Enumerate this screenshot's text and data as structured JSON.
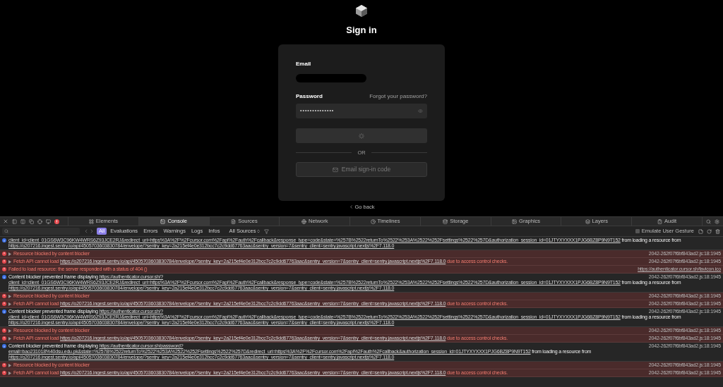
{
  "page": {
    "title": "Sign in",
    "email_label": "Email",
    "password_label": "Password",
    "forgot_link": "Forgot your password?",
    "password_value": "••••••••••••••",
    "submit": {
      "loading": true
    },
    "divider": "OR",
    "email_code_button": {
      "label": "Email sign-in code",
      "disabled": true
    },
    "back_link": "Go back"
  },
  "devtools": {
    "tabs": [
      {
        "label": "Elements",
        "selected": false
      },
      {
        "label": "Console",
        "selected": true
      },
      {
        "label": "Sources",
        "selected": false
      },
      {
        "label": "Network",
        "selected": false
      },
      {
        "label": "Timelines",
        "selected": false
      },
      {
        "label": "Storage",
        "selected": false
      },
      {
        "label": "Graphics",
        "selected": false
      },
      {
        "label": "Layers",
        "selected": false
      },
      {
        "label": "Audit",
        "selected": false
      }
    ],
    "levels": [
      {
        "label": "All",
        "selected": true
      },
      {
        "label": "Evaluations",
        "selected": false
      },
      {
        "label": "Errors",
        "selected": false
      },
      {
        "label": "Warnings",
        "selected": false
      },
      {
        "label": "Logs",
        "selected": false
      },
      {
        "label": "Infos",
        "selected": false
      }
    ],
    "sources_dropdown": "All Sources",
    "emulate_gesture": {
      "label": "Emulate User Gesture",
      "checked": false
    },
    "messages": [
      {
        "kind": "info",
        "expandable": false,
        "lines": [
          [
            {
              "kind": "link",
              "text": "client_id=client_01GS6W3C96KW4WRS6Z93JCE2RJ&redirect_uri=https%3A%2F%2Fcursor.com%2Fapi%2Fauth%2Fcallback&response_type=code&state=%257B%2522returnTo%2522%253A%2522%252Fsettings%2522%257D&authorization_session_id=01JTYXYXXX1PJG6BZ8P9N9T152"
            },
            {
              "kind": "text",
              "text": " from loading a resource from"
            }
          ],
          [
            {
              "kind": "link",
              "text": "https://o207216.ingest.sentry.io/api/4505703603830784/envelope/?sentry_key=2a215ef4e0e312bcc7c2c9dd67763aac&sentry_version=7&sentry_client=sentry.javascript.nextjs%2F7.118.0"
            }
          ]
        ]
      },
      {
        "kind": "error",
        "expandable": true,
        "lines": [
          [
            {
              "kind": "text",
              "text": "Resource blocked by content blocker"
            }
          ]
        ],
        "source": {
          "text": "2042-262f07f6bf843ad2.js:18:1945",
          "link": false
        }
      },
      {
        "kind": "error",
        "expandable": true,
        "lines": [
          [
            {
              "kind": "text",
              "text": "Fetch API cannot load "
            },
            {
              "kind": "link",
              "text": "https://o207216.ingest.sentry.io/api/4505703603830784/envelope/?sentry_key=2a215ef4e0e312bcc7c2c9dd67763aac&sentry_version=7&sentry_client=sentry.javascript.nextjs%2F7.118.0"
            },
            {
              "kind": "text",
              "text": " due to access control checks."
            }
          ]
        ],
        "source": {
          "text": "2042-262f07f6bf843ad2.js:18:1945",
          "link": false
        }
      },
      {
        "kind": "error",
        "expandable": false,
        "lines": [
          [
            {
              "kind": "text",
              "text": "Failed to load resource: the server responded with a status of 404 ()"
            }
          ]
        ],
        "source": {
          "text": "https://authenticator.cursor.sh/favicon.ico",
          "link": true
        }
      },
      {
        "kind": "info",
        "expandable": false,
        "lines": [
          [
            {
              "kind": "text",
              "text": "Content blocker prevented frame displaying "
            },
            {
              "kind": "link",
              "text": "https://authenticator.cursor.sh/?"
            }
          ],
          [
            {
              "kind": "link",
              "text": "client_id=client_01GS6W3C96KW4WRS6Z93JCE2RJ&redirect_uri=https%3A%2F%2Fcursor.com%2Fapi%2Fauth%2Fcallback&response_type=code&state=%257B%2522returnTo%2522%253A%2522%252Fsettings%2522%257D&authorization_session_id=01JTYXYXXX1PJG6BZ8P9N9T152"
            },
            {
              "kind": "text",
              "text": " from loading a resource from"
            }
          ],
          [
            {
              "kind": "link",
              "text": "https://o207216.ingest.sentry.io/api/4505703603830784/envelope/?sentry_key=2a215ef4e0e312bcc7c2c9dd67763aac&sentry_version=7&sentry_client=sentry.javascript.nextjs%2F7.118.0"
            }
          ]
        ],
        "source": {
          "text": "2042-262f07f6bf843ad2.js:18:1945",
          "link": false
        }
      },
      {
        "kind": "error",
        "expandable": true,
        "lines": [
          [
            {
              "kind": "text",
              "text": "Resource blocked by content blocker"
            }
          ]
        ],
        "source": {
          "text": "2042-262f07f6bf843ad2.js:18:1945",
          "link": false
        }
      },
      {
        "kind": "error",
        "expandable": true,
        "lines": [
          [
            {
              "kind": "text",
              "text": "Fetch API cannot load "
            },
            {
              "kind": "link",
              "text": "https://o207216.ingest.sentry.io/api/4505703603830784/envelope/?sentry_key=2a215ef4e0e312bcc7c2c9dd67763aac&sentry_version=7&sentry_client=sentry.javascript.nextjs%2F7.118.0"
            },
            {
              "kind": "text",
              "text": " due to access control checks."
            }
          ]
        ],
        "source": {
          "text": "2042-262f07f6bf843ad2.js:18:1945",
          "link": false
        }
      },
      {
        "kind": "info",
        "expandable": false,
        "lines": [
          [
            {
              "kind": "text",
              "text": "Content blocker prevented frame displaying "
            },
            {
              "kind": "link",
              "text": "https://authenticator.cursor.sh/?"
            }
          ],
          [
            {
              "kind": "link",
              "text": "client_id=client_01GS6W3C96KW4WRS6Z93JCE2RJ&redirect_uri=https%3A%2F%2Fcursor.com%2Fapi%2Fauth%2Fcallback&response_type=code&state=%257B%2522returnTo%2522%253A%2522%252Fsettings%2522%257D&authorization_session_id=01JTYXYXXX1PJG6BZ8P9N9T152"
            },
            {
              "kind": "text",
              "text": " from loading a resource from"
            }
          ],
          [
            {
              "kind": "link",
              "text": "https://o207216.ingest.sentry.io/api/4505703603830784/envelope/?sentry_key=2a215ef4e0e312bcc7c2c9dd67763aac&sentry_version=7&sentry_client=sentry.javascript.nextjs%2F7.118.0"
            }
          ]
        ],
        "source": {
          "text": "2042-262f07f6bf843ad2.js:18:1945",
          "link": false
        }
      },
      {
        "kind": "error",
        "expandable": true,
        "lines": [
          [
            {
              "kind": "text",
              "text": "Resource blocked by content blocker"
            }
          ]
        ],
        "source": {
          "text": "2042-262f07f6bf843ad2.js:18:1945",
          "link": false
        }
      },
      {
        "kind": "error",
        "expandable": true,
        "lines": [
          [
            {
              "kind": "text",
              "text": "Fetch API cannot load "
            },
            {
              "kind": "link",
              "text": "https://o207216.ingest.sentry.io/api/4505703603830784/envelope/?sentry_key=2a215ef4e0e312bcc7c2c9dd67763aac&sentry_version=7&sentry_client=sentry.javascript.nextjs%2F7.118.0"
            },
            {
              "kind": "text",
              "text": " due to access control checks."
            }
          ]
        ],
        "source": {
          "text": "2042-262f07f6bf843ad2.js:18:1945",
          "link": false
        }
      },
      {
        "kind": "info",
        "expandable": false,
        "lines": [
          [
            {
              "kind": "text",
              "text": "Content blocker prevented frame displaying "
            },
            {
              "kind": "link",
              "text": "https://authenticator.cursor.sh/password?"
            }
          ],
          [
            {
              "kind": "link",
              "text": "email=bao231018%40dsu.edu.pk&state=%257B%2522returnTo%2522%253A%2522%252Fsettings%2522%257D&redirect_uri=https%3A%2F%2Fcursor.com%2Fapi%2Fauth%2Fcallback&authorization_session_id=01JTYXYXXX1PJG6BZ8P9N9T152"
            },
            {
              "kind": "text",
              "text": " from loading a resource from"
            }
          ],
          [
            {
              "kind": "link",
              "text": "https://o207216.ingest.sentry.io/api/4505703603830784/envelope/?sentry_key=2a215ef4e0e312bcc7c2c9dd67763aac&sentry_version=7&sentry_client=sentry.javascript.nextjs%2F7.118.0"
            }
          ]
        ],
        "source": {
          "text": "2042-262f07f6bf843ad2.js:18:1945",
          "link": false
        }
      },
      {
        "kind": "error",
        "expandable": true,
        "lines": [
          [
            {
              "kind": "text",
              "text": "Resource blocked by content blocker"
            }
          ]
        ],
        "source": {
          "text": "2042-262f07f6bf843ad2.js:18:1945",
          "link": false
        }
      },
      {
        "kind": "error",
        "expandable": true,
        "lines": [
          [
            {
              "kind": "text",
              "text": "Fetch API cannot load "
            },
            {
              "kind": "link",
              "text": "https://o207216.ingest.sentry.io/api/4505703603830784/envelope/?sentry_key=2a215ef4e0e312bcc7c2c9dd67763aac&sentry_version=7&sentry_client=sentry.javascript.nextjs%2F7.118.0"
            },
            {
              "kind": "text",
              "text": " due to access control checks."
            }
          ]
        ],
        "source": {
          "text": "2042-262f07f6bf843ad2.js:18:1945",
          "link": false
        }
      }
    ]
  }
}
